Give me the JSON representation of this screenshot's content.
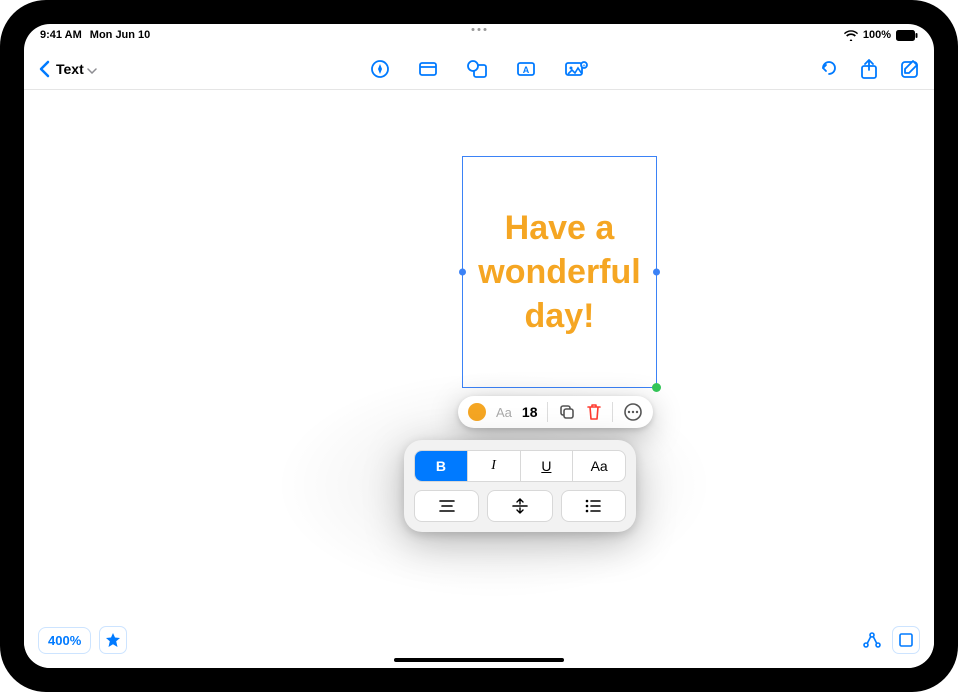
{
  "status": {
    "time": "9:41 AM",
    "date": "Mon Jun 10",
    "battery": "100%"
  },
  "toolbar": {
    "tool_label": "Text"
  },
  "textbox": {
    "content": "Have a wonderful day!",
    "color": "#f5a623"
  },
  "context_toolbar": {
    "font_size": "18",
    "font_sample": "Aa"
  },
  "format_panel": {
    "bold": "B",
    "italic": "I",
    "underline": "U",
    "case": "Aa"
  },
  "bottom": {
    "zoom": "400%"
  }
}
